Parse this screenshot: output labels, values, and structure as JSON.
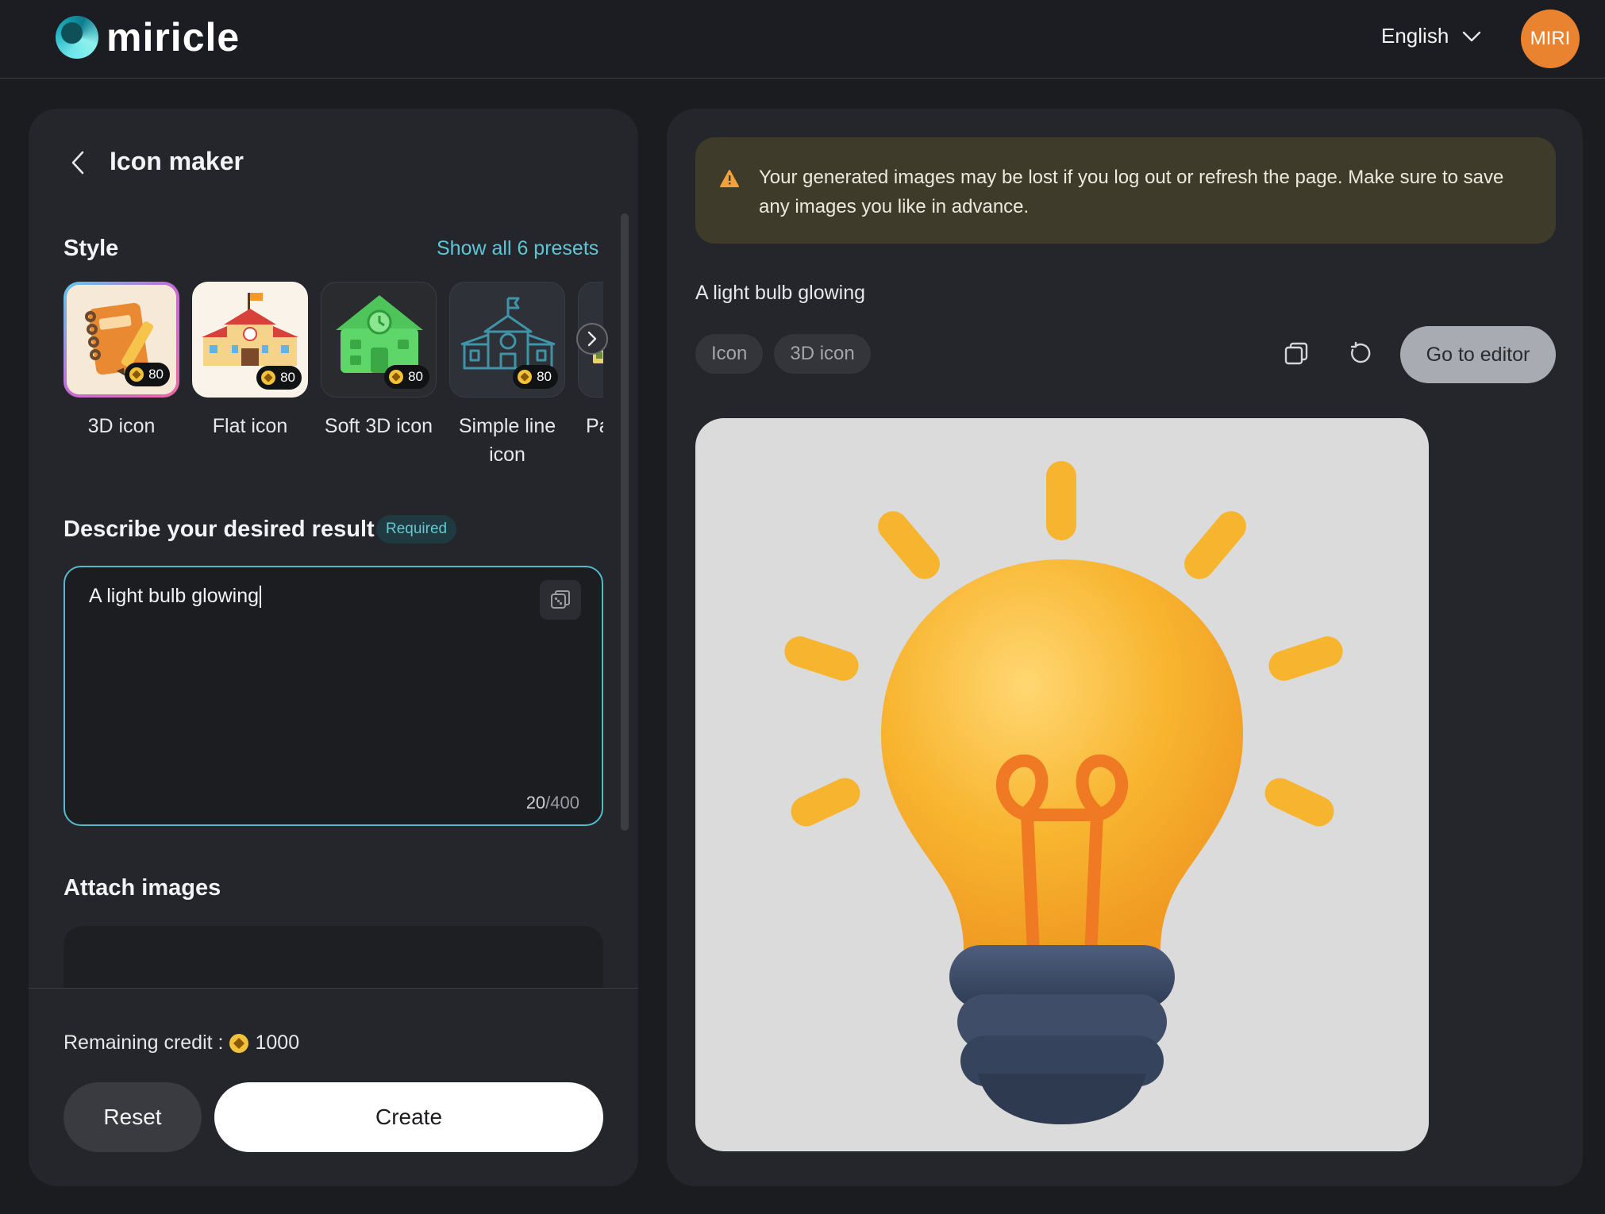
{
  "header": {
    "brand": "miricle",
    "language": "English",
    "avatar_initials": "MIRI"
  },
  "left": {
    "title": "Icon maker",
    "style_label": "Style",
    "show_all": "Show all 6 presets",
    "presets": [
      {
        "label": "3D icon",
        "cost": "80",
        "selected": true
      },
      {
        "label": "Flat icon",
        "cost": "80"
      },
      {
        "label": "Soft 3D icon",
        "cost": "80"
      },
      {
        "label": "Simple line icon",
        "cost": "80"
      },
      {
        "label": "Pa"
      }
    ],
    "describe_label": "Describe your desired result",
    "required": "Required",
    "prompt_value": "A light bulb glowing",
    "char_count": "20",
    "char_max": "/400",
    "attach_label": "Attach images",
    "credit_label": "Remaining credit :",
    "credit_value": "1000",
    "reset": "Reset",
    "create": "Create"
  },
  "right": {
    "notice": "Your generated images may be lost if you log out or refresh the page. Make sure to save any images you like in advance.",
    "prompt": "A light bulb glowing",
    "tags": [
      "Icon",
      "3D icon"
    ],
    "editor": "Go to editor"
  },
  "colors": {
    "accent": "#5fc4d6",
    "avatar": "#e98330",
    "warning": "#f2a23c",
    "bulb": "#f8b530",
    "filament": "#f07a23",
    "base": "#3b4a66"
  }
}
